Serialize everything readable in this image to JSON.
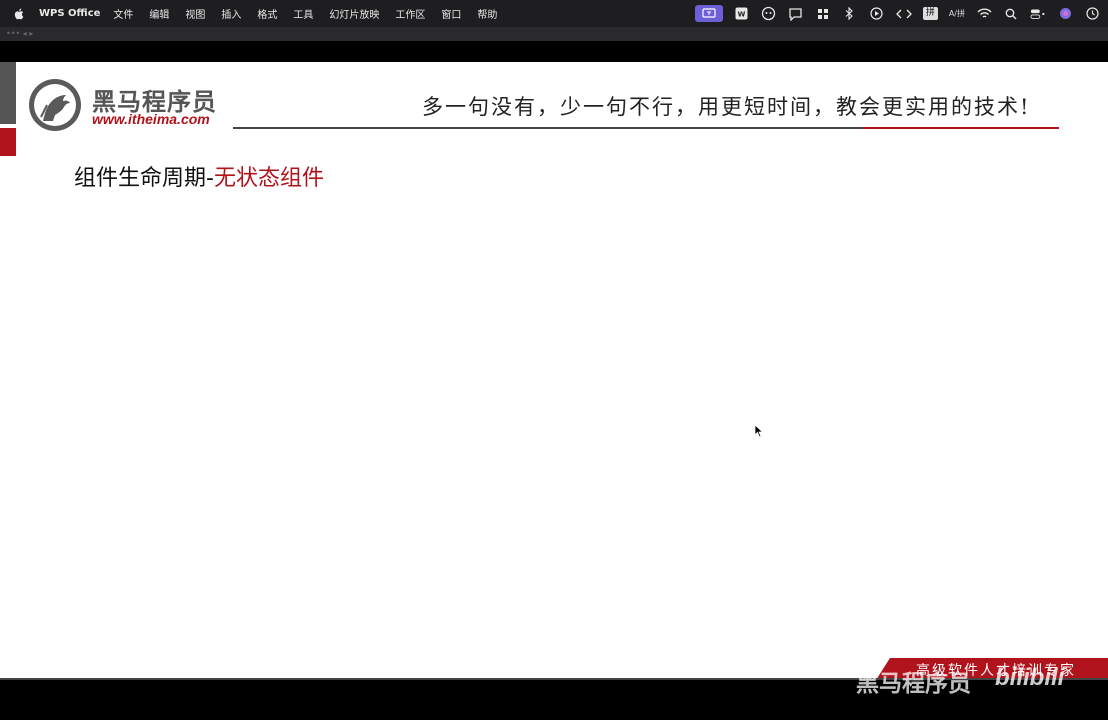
{
  "menubar": {
    "app_name": "WPS Office",
    "items": [
      "文件",
      "编辑",
      "视图",
      "插入",
      "格式",
      "工具",
      "幻灯片放映",
      "工作区",
      "窗口",
      "帮助"
    ],
    "pinyin": "拼",
    "caps": "A/拼"
  },
  "strip_text": "••• ◂ ▸",
  "slide": {
    "logo_name": "黑马程序员",
    "logo_url": "www.itheima.com",
    "slogan": "多一句没有，少一句不行，用更短时间，教会更实用的技术!",
    "title_black": "组件生命周期-",
    "title_red": "无状态组件",
    "banner_text": "高级软件人才培训专家"
  },
  "watermark": {
    "text": "黑马程序员",
    "bilibili": "bilibili"
  },
  "colors": {
    "accent_red": "#b1131c",
    "menubar_bg": "#1e1e20",
    "tray_active": "#6d5fd6"
  },
  "icons": [
    "apple-icon",
    "screen-record-icon",
    "wps-icon",
    "cat-icon",
    "chat-icon",
    "grid-icon",
    "bluetooth-icon",
    "play-icon",
    "code-icon",
    "wifi-icon",
    "search-icon",
    "control-center-icon",
    "siri-icon",
    "clock-icon"
  ]
}
